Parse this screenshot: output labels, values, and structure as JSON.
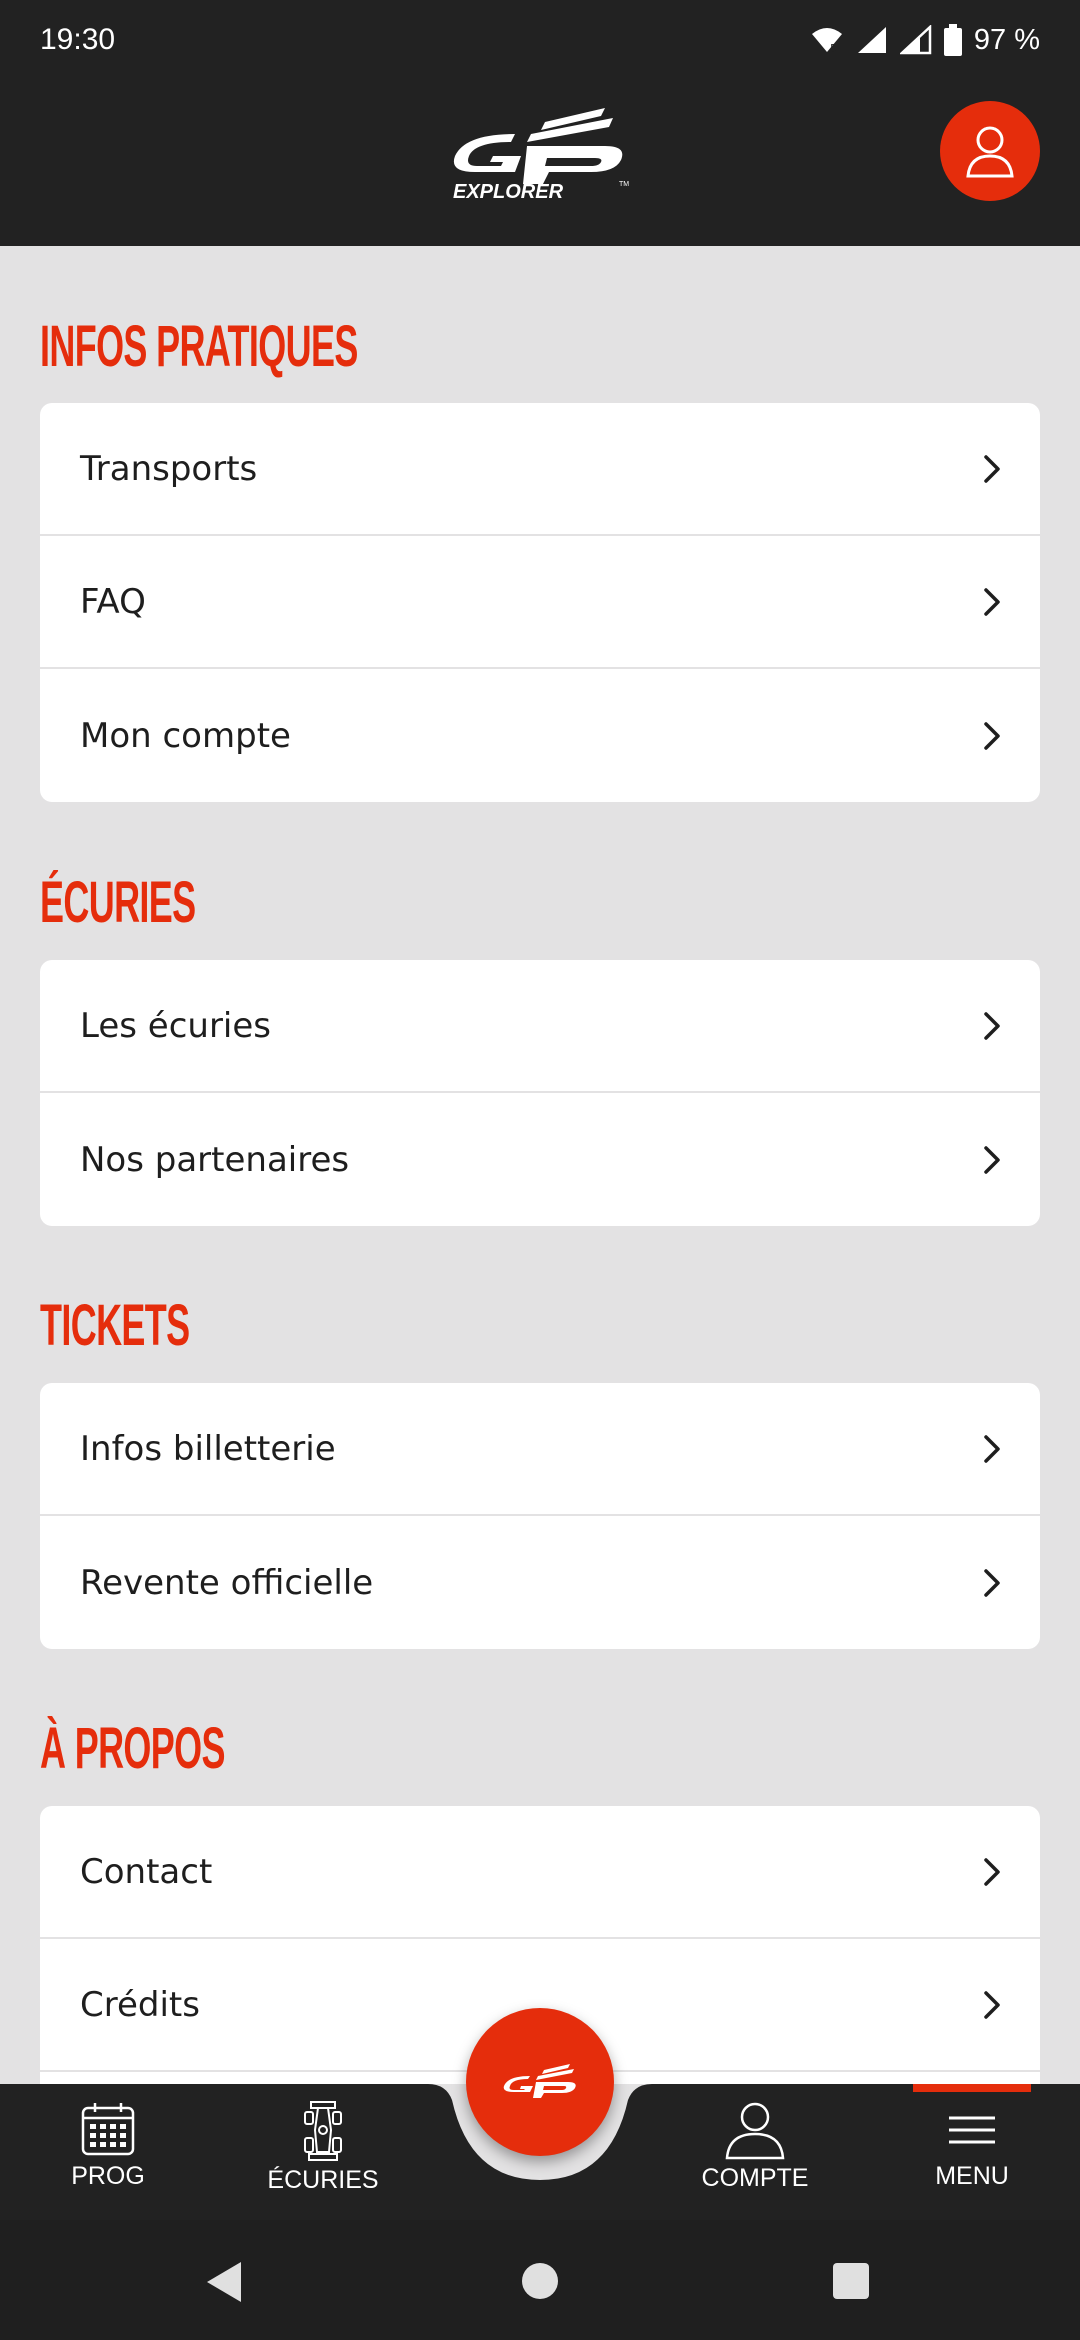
{
  "status_bar": {
    "time": "19:30",
    "battery": "97 %"
  },
  "header": {
    "logo_text": "EXPLORER",
    "profile_icon": "user-icon"
  },
  "sections": [
    {
      "title": "INFOS PRATIQUES",
      "items": [
        {
          "label": "Transports"
        },
        {
          "label": "FAQ"
        },
        {
          "label": "Mon compte"
        }
      ]
    },
    {
      "title": "ÉCURIES",
      "items": [
        {
          "label": "Les écuries"
        },
        {
          "label": "Nos partenaires"
        }
      ]
    },
    {
      "title": "TICKETS",
      "items": [
        {
          "label": "Infos billetterie"
        },
        {
          "label": "Revente officielle"
        }
      ]
    },
    {
      "title": "À PROPOS",
      "items": [
        {
          "label": "Contact"
        },
        {
          "label": "Crédits"
        }
      ]
    }
  ],
  "bottom_nav": {
    "items": [
      {
        "label": "PROG",
        "icon": "calendar-icon"
      },
      {
        "label": "ÉCURIES",
        "icon": "race-car-icon"
      },
      {
        "label": "COMPTE",
        "icon": "user-icon"
      },
      {
        "label": "MENU",
        "icon": "menu-icon"
      }
    ],
    "active": "MENU"
  },
  "colors": {
    "accent": "#e52d0c",
    "dark": "#222222",
    "background": "#e3e2e3"
  }
}
